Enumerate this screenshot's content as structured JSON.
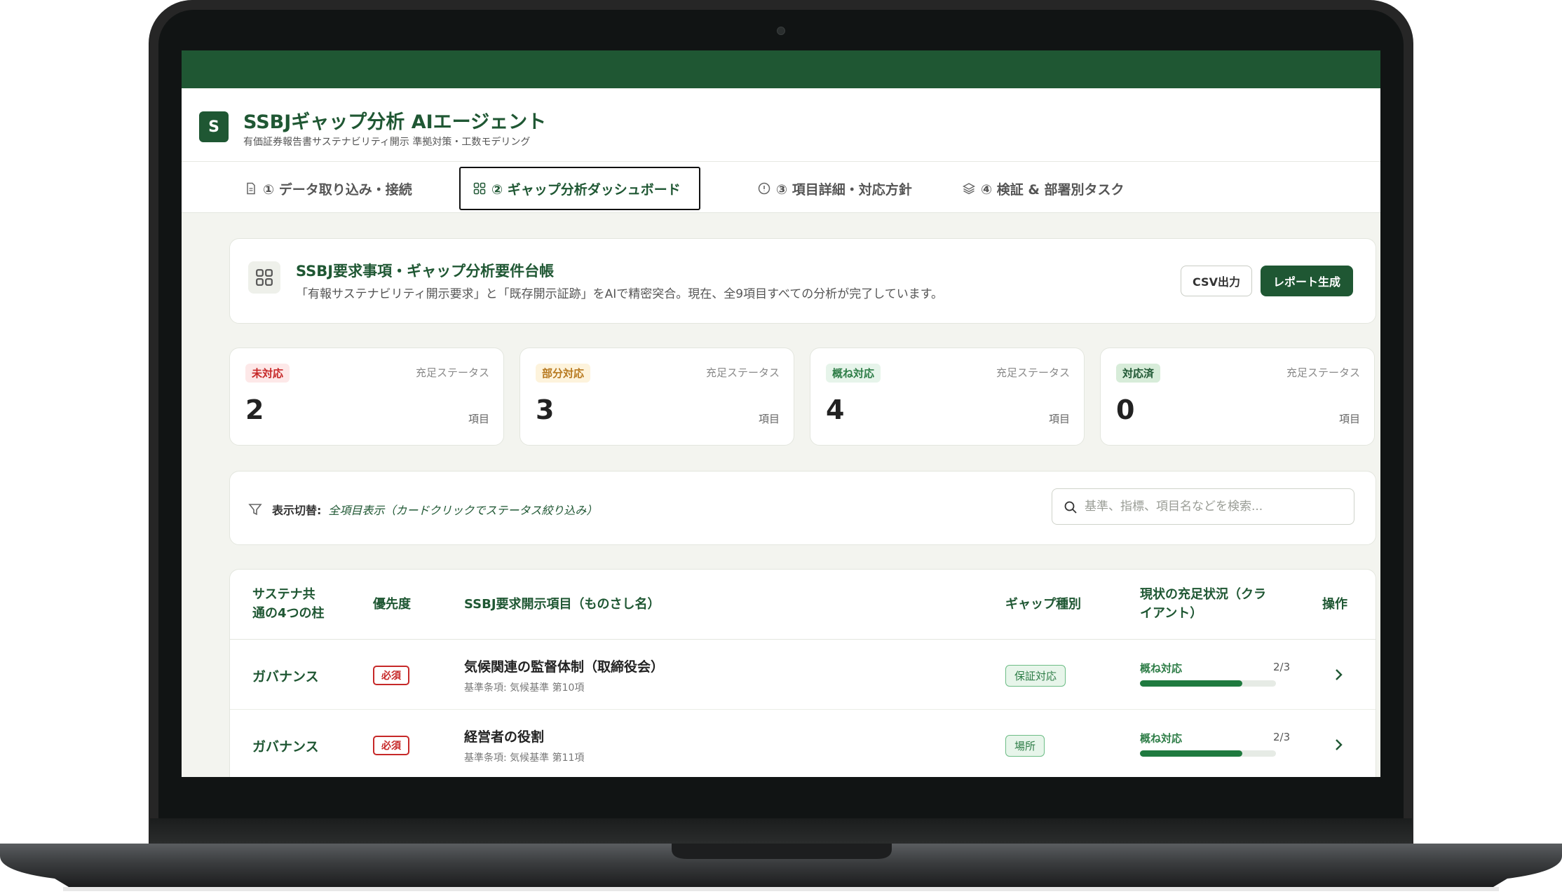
{
  "app": {
    "logo_letter": "S",
    "title": "SSBJギャップ分析 AIエージェント",
    "subtitle": "有価証券報告書サステナビリティ開示 準拠対策・工数モデリング"
  },
  "tabs": [
    {
      "label": "① データ取り込み・接続",
      "icon": "document-icon",
      "active": false
    },
    {
      "label": "② ギャップ分析ダッシュボード",
      "icon": "grid-icon",
      "active": true
    },
    {
      "label": "③ 項目詳細・対応方針",
      "icon": "info-icon",
      "active": false
    },
    {
      "label": "④ 検証 & 部署別タスク",
      "icon": "layers-icon",
      "active": false
    }
  ],
  "hero": {
    "title": "SSBJ要求事項・ギャップ分析要件台帳",
    "description": "「有報サステナビリティ開示要求」と「既存開示証跡」をAIで精密突合。現在、全9項目すべての分析が完了しています。",
    "csv_button": "CSV出力",
    "report_button": "レポート生成"
  },
  "stats": [
    {
      "badge": "未対応",
      "label": "充足ステータス",
      "value": "2",
      "unit": "項目",
      "color": "#c62828",
      "bg": "#fde8e8"
    },
    {
      "badge": "部分対応",
      "label": "充足ステータス",
      "value": "3",
      "unit": "項目",
      "color": "#b7791f",
      "bg": "#fdf3dc"
    },
    {
      "badge": "概ね対応",
      "label": "充足ステータス",
      "value": "4",
      "unit": "項目",
      "color": "#2e7d47",
      "bg": "#e6f4ea"
    },
    {
      "badge": "対応済",
      "label": "充足ステータス",
      "value": "0",
      "unit": "項目",
      "color": "#1f5733",
      "bg": "#d7ecd9"
    }
  ],
  "filter": {
    "label": "表示切替:",
    "value": "全項目表示（カードクリックでステータス絞り込み）",
    "search_placeholder": "基準、指標、項目名などを検索..."
  },
  "table": {
    "headers": [
      "サステナ共\n通の4つの柱",
      "優先度",
      "SSBJ要求開示項目（ものさし名）",
      "ギャップ種別",
      "現状の充足状況（クラ\nイアント）",
      "操作"
    ],
    "rows": [
      {
        "pillar": "ガバナンス",
        "priority": "必須",
        "name": "気候関連の監督体制（取締役会）",
        "ref": "基準条項: 気候基準 第10項",
        "gap": "保証対応",
        "status": "概ね対応",
        "count": "2/3",
        "progress": 0.75
      },
      {
        "pillar": "ガバナンス",
        "priority": "必須",
        "name": "経営者の役割",
        "ref": "基準条項: 気候基準 第11項",
        "gap": "場所",
        "status": "概ね対応",
        "count": "2/3",
        "progress": 0.75
      }
    ]
  }
}
